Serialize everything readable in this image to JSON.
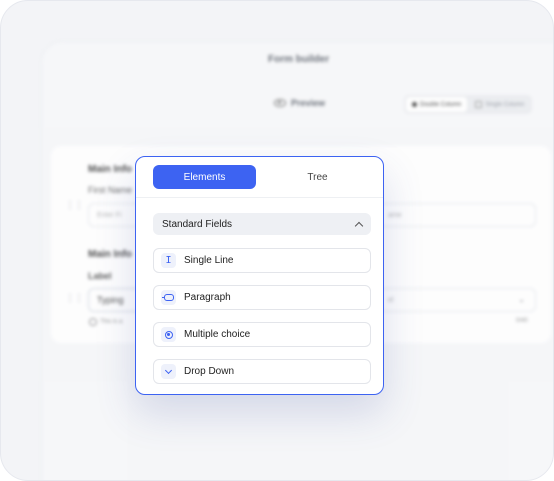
{
  "background": {
    "app_title": "Form builder",
    "preview_label": "Preview",
    "layout_options": [
      "Double Column",
      "Single Column"
    ],
    "sections": [
      {
        "heading": "Main Info",
        "field_label": "First Name",
        "placeholder": "Enter Fi",
        "right_placeholder": "ame"
      },
      {
        "heading": "Main Info",
        "field_label": "Label",
        "value": "Typing",
        "hint": "This is a",
        "right_hint": "0/40",
        "right_suffix": "el"
      }
    ]
  },
  "popover": {
    "tabs": [
      {
        "label": "Elements",
        "active": true
      },
      {
        "label": "Tree",
        "active": false
      }
    ],
    "section_title": "Standard Fields",
    "fields": [
      {
        "label": "Single Line",
        "icon": "text-cursor-icon"
      },
      {
        "label": "Paragraph",
        "icon": "paragraph-icon"
      },
      {
        "label": "Multiple choice",
        "icon": "radio-icon"
      },
      {
        "label": "Drop Down",
        "icon": "chevron-down-icon"
      }
    ]
  },
  "colors": {
    "accent": "#3d63f2",
    "panel_bg": "#ffffff",
    "page_bg": "#f3f4f7"
  }
}
